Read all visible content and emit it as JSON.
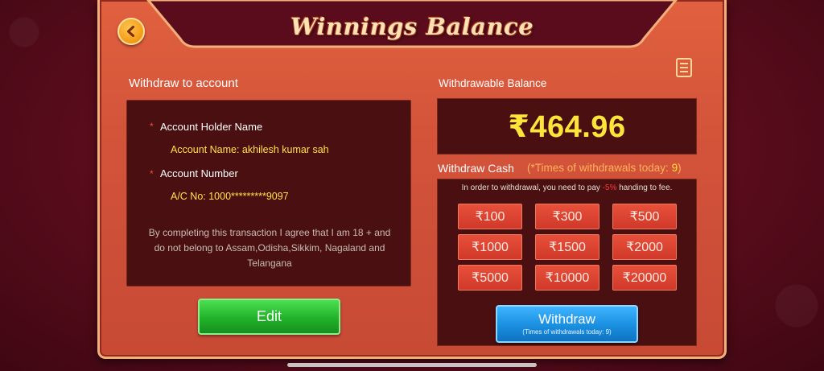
{
  "header": {
    "title": "Winnings Balance",
    "back_icon": "chevron-left-icon",
    "doc_icon": "document-icon"
  },
  "account": {
    "section_label": "Withdraw to account",
    "holder_label": "Account Holder Name",
    "holder_value": "Account Name: akhilesh kumar sah",
    "number_label": "Account Number",
    "number_value": "A/C No: 1000*********9097",
    "required_mark": "*",
    "disclaimer": "By completing this transaction I agree that I am 18 + and do not belong to Assam,Odisha,Sikkim, Nagaland and Telangana",
    "edit_label": "Edit"
  },
  "balance": {
    "label": "Withdrawable Balance",
    "value": "₹464.96"
  },
  "withdraw": {
    "cash_label": "Withdraw Cash",
    "times_prefix": "(*Times of withdrawals today: ",
    "times_count": "9",
    "times_suffix": ")",
    "fee_prefix": "In order to withdrawal, you need to pay ",
    "fee_pct": "-5%",
    "fee_suffix": " handing to fee.",
    "amounts": [
      "₹100",
      "₹300",
      "₹500",
      "₹1000",
      "₹1500",
      "₹2000",
      "₹5000",
      "₹10000",
      "₹20000"
    ],
    "button_label": "Withdraw",
    "button_sub": "(Times of withdrawals today: 9)"
  },
  "colors": {
    "panel": "#d3533a",
    "box": "#4a0f10",
    "balance_text": "#ffe53a",
    "edit_button": "#22b22a",
    "withdraw_button": "#1a8fe0"
  }
}
